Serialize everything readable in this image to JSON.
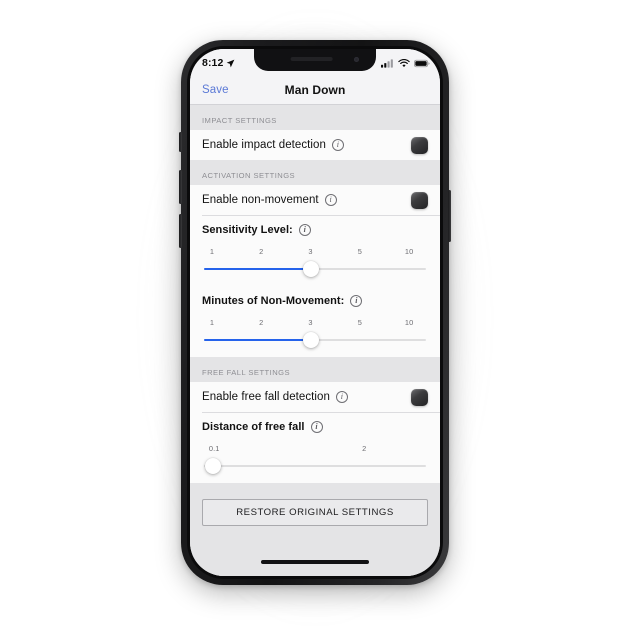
{
  "status_bar": {
    "time": "8:12",
    "location_icon": "location-arrow-icon",
    "cellular_icon": "cellular-bars-icon",
    "wifi_icon": "wifi-icon",
    "battery_icon": "battery-icon"
  },
  "nav": {
    "save_label": "Save",
    "title": "Man Down"
  },
  "colors": {
    "accent_blue": "#2563eb",
    "link_blue": "#5b79d6",
    "section_header_text": "#8e8e93",
    "row_background": "#fbfbfb",
    "page_background": "#e4e4e6",
    "toggle_dark": "#232325"
  },
  "sections": [
    {
      "header": "IMPACT SETTINGS",
      "rows": [
        {
          "label": "Enable impact detection",
          "info_icon": "info-circle-icon",
          "control": "toggle"
        }
      ]
    },
    {
      "header": "ACTIVATION SETTINGS",
      "rows": [
        {
          "label": "Enable non-movement",
          "info_icon": "info-circle-icon",
          "control": "toggle"
        },
        {
          "label": "Sensitivity Level:",
          "info_icon": "info-circle-icon",
          "control": "slider"
        },
        {
          "label": "Minutes of Non-Movement:",
          "info_icon": "info-circle-icon",
          "control": "slider"
        }
      ]
    },
    {
      "header": "FREE FALL SETTINGS",
      "rows": [
        {
          "label": "Enable free fall detection",
          "info_icon": "info-circle-icon",
          "control": "toggle"
        },
        {
          "label": "Distance of free fall",
          "info_icon": "info-circle-icon",
          "control": "slider"
        }
      ]
    }
  ],
  "sliders": {
    "sensitivity": {
      "ticks": [
        "1",
        "2",
        "3",
        "5",
        "10"
      ],
      "tick_positions_pct": [
        4,
        26,
        48,
        70,
        92
      ],
      "value": "3",
      "thumb_pct": 48,
      "filled": true
    },
    "minutes_non_movement": {
      "ticks": [
        "1",
        "2",
        "3",
        "5",
        "10"
      ],
      "tick_positions_pct": [
        4,
        26,
        48,
        70,
        92
      ],
      "value": "3",
      "thumb_pct": 48,
      "filled": true
    },
    "distance_free_fall": {
      "ticks": [
        "0.1",
        "2"
      ],
      "tick_positions_pct": [
        3,
        72
      ],
      "value": "0.1",
      "thumb_pct": 3,
      "filled": false
    }
  },
  "footer": {
    "restore_label": "RESTORE ORIGINAL SETTINGS"
  },
  "home_indicator": "home-indicator"
}
